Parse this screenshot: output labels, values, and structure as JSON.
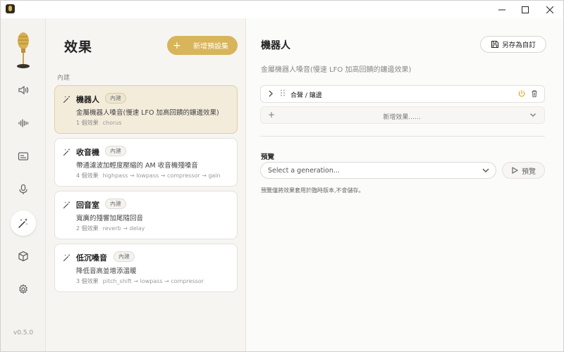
{
  "window": {
    "minimize_symbol": "—",
    "maximize_symbol": "☐",
    "close_symbol": "✕"
  },
  "sidebar": {
    "version": "v0.5.0",
    "items": [
      {
        "name": "speaker-icon"
      },
      {
        "name": "waveform-icon"
      },
      {
        "name": "subtitles-icon"
      },
      {
        "name": "microphone-icon"
      },
      {
        "name": "magic-wand-icon",
        "active": true
      },
      {
        "name": "cube-icon"
      },
      {
        "name": "gear-icon"
      }
    ]
  },
  "list": {
    "title": "效果",
    "new_preset_label": "新增預設集",
    "new_preset_plus": "+",
    "section_label": "內建",
    "presets": [
      {
        "name": "機器人",
        "badge": "內建",
        "description": "金屬機器人嗓音(慢速 LFO 加高回饋的鑲邊效果)",
        "count": "1 個效果",
        "chain": "chorus",
        "selected": true
      },
      {
        "name": "收音機",
        "badge": "內建",
        "description": "帶通濾波加輕度壓縮的 AM 收音機殘嗓音",
        "count": "4 個效果",
        "chain": "highpass → lowpass → compressor → gain",
        "selected": false
      },
      {
        "name": "回音室",
        "badge": "內建",
        "description": "寬廣的殘響加尾隨回音",
        "count": "2 個效果",
        "chain": "reverb → delay",
        "selected": false
      },
      {
        "name": "低沉嗓音",
        "badge": "內建",
        "description": "降低音高並增添溫暖",
        "count": "3 個效果",
        "chain": "pitch_shift → lowpass → compressor",
        "selected": false
      }
    ]
  },
  "detail": {
    "title": "機器人",
    "save_as_label": "另存為自訂",
    "description": "金屬機器人嗓音(慢速 LFO 加高回饋的鑲邊效果)",
    "effects": [
      {
        "name": "合聲 / 鑲邊"
      }
    ],
    "add_effect_label": "新增效果......",
    "add_effect_plus": "+",
    "preview_label": "預覽",
    "generation_placeholder": "Select a generation...",
    "preview_button_label": "預覽",
    "preview_note": "預覽僅將效果套用於臨時版本,不會儲存。"
  },
  "colors": {
    "accent": "#d8b45a",
    "selected_card_bg": "#f3ecdb",
    "power_icon": "#d9a936"
  }
}
